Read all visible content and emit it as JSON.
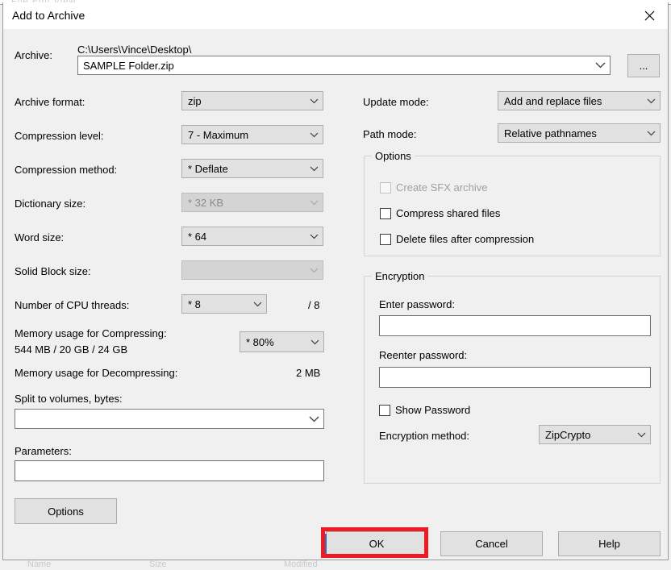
{
  "window": {
    "title": "Add to Archive",
    "close_icon": "close-icon"
  },
  "archive": {
    "label": "Archive:",
    "path_text": "C:\\Users\\Vince\\Desktop\\",
    "name_value": "SAMPLE Folder.zip",
    "name_placeholder": "",
    "browse_label": "...",
    "dropdown_icon": "chevron-down-icon"
  },
  "left_column": {
    "archive_format": {
      "label": "Archive format:",
      "value": "zip"
    },
    "compression_level": {
      "label": "Compression level:",
      "value": "7 - Maximum"
    },
    "compression_method": {
      "label": "Compression method:",
      "value": "*  Deflate"
    },
    "dictionary_size": {
      "label": "Dictionary size:",
      "value": "*  32 KB",
      "disabled": true
    },
    "word_size": {
      "label": "Word size:",
      "value": "*  64"
    },
    "solid_block_size": {
      "label": "Solid Block size:",
      "value": "",
      "disabled": true
    },
    "cpu_threads": {
      "label": "Number of CPU threads:",
      "value": "*  8",
      "total": "/ 8"
    },
    "memory_compress": {
      "label": "Memory usage for Compressing:",
      "detail": "544 MB / 20 GB / 24 GB",
      "value": "*  80%"
    },
    "memory_decompress": {
      "label": "Memory usage for Decompressing:",
      "value": "2 MB"
    },
    "split_volumes": {
      "label": "Split to volumes, bytes:",
      "value": "",
      "placeholder": ""
    },
    "parameters": {
      "label": "Parameters:",
      "value": "",
      "placeholder": ""
    }
  },
  "right_column": {
    "update_mode": {
      "label": "Update mode:",
      "value": "Add and replace files"
    },
    "path_mode": {
      "label": "Path mode:",
      "value": "Relative pathnames"
    },
    "options_group": {
      "title": "Options",
      "items": [
        {
          "label": "Create SFX archive",
          "checked": false,
          "disabled": true
        },
        {
          "label": "Compress shared files",
          "checked": false,
          "disabled": false
        },
        {
          "label": "Delete files after compression",
          "checked": false,
          "disabled": false
        }
      ]
    },
    "encryption_group": {
      "title": "Encryption",
      "enter_password_label": "Enter password:",
      "enter_password_value": "",
      "reenter_password_label": "Reenter password:",
      "reenter_password_value": "",
      "show_password": {
        "label": "Show Password",
        "checked": false
      },
      "encryption_method": {
        "label": "Encryption method:",
        "value": "ZipCrypto"
      }
    }
  },
  "footer": {
    "options_label": "Options",
    "ok_label": "OK",
    "cancel_label": "Cancel",
    "help_label": "Help"
  },
  "annotation": {
    "highlight_color": "#ee1b22",
    "highlight_target": "ok-button"
  },
  "background": {
    "menu_ghost": "File   Edit   View",
    "status_ghost_1": "Name",
    "status_ghost_2": "Size",
    "status_ghost_3": "Modified"
  }
}
